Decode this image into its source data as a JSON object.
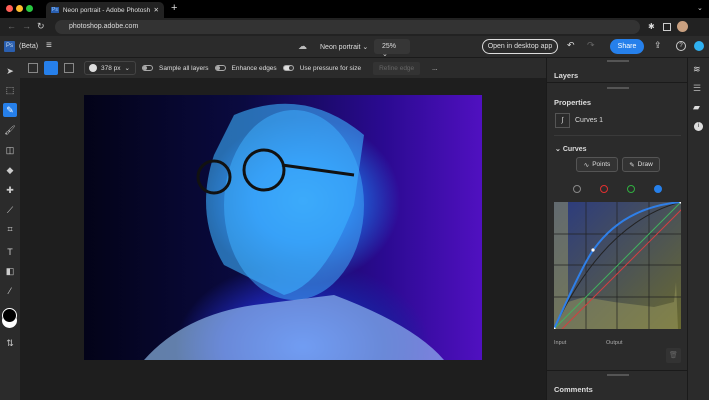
{
  "browser": {
    "tab_title": "Neon portrait - Adobe Photoshop",
    "url": "photoshop.adobe.com"
  },
  "app": {
    "beta_label": "(Beta)",
    "doc_name": "Neon portrait",
    "zoom": "25%",
    "open_desktop": "Open in desktop app",
    "share": "Share"
  },
  "options": {
    "brush_size": "378 px",
    "sample_all_layers": "Sample all layers",
    "sample_all_layers_on": false,
    "enhance_edges": "Enhance edges",
    "enhance_edges_on": false,
    "use_pressure": "Use pressure for size",
    "use_pressure_on": true,
    "refine_edge": "Refine edge",
    "more": "..."
  },
  "panel": {
    "layers": "Layers",
    "properties": "Properties",
    "layer_name": "Curves 1",
    "curves": "Curves",
    "points": "Points",
    "draw": "Draw",
    "input": "Input",
    "output": "Output",
    "comments": "Comments"
  },
  "channel_colors": [
    "#888888",
    "#e03030",
    "#30b040",
    "#2680eb"
  ],
  "colors": {
    "accent": "#2680eb"
  }
}
